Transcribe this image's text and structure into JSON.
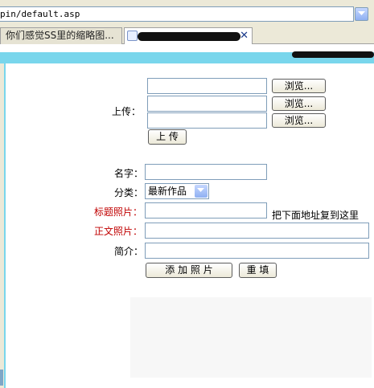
{
  "address_bar": {
    "url": "pin/default.asp"
  },
  "tabs": [
    {
      "label": "你们感觉SS里的缩略图..."
    },
    {
      "label": ""
    }
  ],
  "form": {
    "upload_label": "上传：",
    "browse_label": "浏览...",
    "upload_button": "上 传",
    "name_label": "名字：",
    "category_label": "分类：",
    "category_selected": "最新作品",
    "title_photo_label": "标题照片：",
    "copy_hint": "把下面地址复到这里",
    "body_photo_label": "正文照片：",
    "intro_label": "简介：",
    "add_photo_button": "添 加 照 片",
    "reset_button": "重 填"
  },
  "colors": {
    "banner": "#79d6ec",
    "red_label": "#c00000"
  }
}
